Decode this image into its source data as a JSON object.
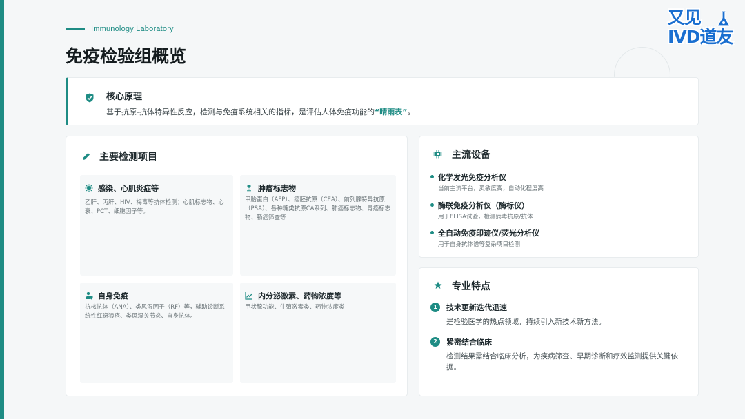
{
  "header": {
    "subtitle": "Immunology Laboratory",
    "title": "免疫检验组概览"
  },
  "logo": {
    "line1": "又见",
    "line2": "IVD道友"
  },
  "principle": {
    "title": "核心原理",
    "desc_prefix": "基于抗原-抗体特异性反应，检测与免疫系统相关的指标，是评估人体免疫功能的",
    "desc_highlight": "“晴雨表”",
    "desc_suffix": "。",
    "icon": "shield-check-icon"
  },
  "items": {
    "title": "主要检测项目",
    "icon": "pencil-icon",
    "cards": [
      {
        "title": "感染、心肌炎症等",
        "icon": "virus-icon",
        "desc": "乙肝、丙肝、HIV、梅毒等抗体检测；心肌标志物、心衰、PCT、细胞因子等。"
      },
      {
        "title": "肿瘤标志物",
        "icon": "ribbon-icon",
        "desc": "甲胎蛋白（AFP）、癌胚抗原（CEA）、前列腺特异抗原（PSA）、各种糖类抗原CA系列、肺癌标志物、胃癌标志物、肠癌筛查等"
      },
      {
        "title": "自身免疫",
        "icon": "user-shield-icon",
        "desc": "抗核抗体（ANA）、类风湿因子（RF）等，辅助诊断系统性红斑狼疮、类风湿关节炎、自身抗体。"
      },
      {
        "title": "内分泌激素、药物浓度等",
        "icon": "chart-line-icon",
        "desc": "甲状腺功能、生殖激素类、药物浓度类"
      }
    ]
  },
  "equipment": {
    "title": "主流设备",
    "icon": "chip-icon",
    "list": [
      {
        "name": "化学发光免疫分析仪",
        "desc": "当前主流平台，灵敏度高，自动化程度高"
      },
      {
        "name": "酶联免疫分析仪（酶标仪）",
        "desc": "用于ELISA试验，检测病毒抗原/抗体"
      },
      {
        "name": "全自动免疫印迹仪/荧光分析仪",
        "desc": "用于自身抗体谱等复杂项目检测"
      }
    ]
  },
  "features": {
    "title": "专业特点",
    "icon": "star-icon",
    "list": [
      {
        "num": "1",
        "title": "技术更新迭代迅速",
        "desc": "是检验医学的热点领域，持续引入新技术新方法。"
      },
      {
        "num": "2",
        "title": "紧密结合临床",
        "desc": "检测结果需结合临床分析，为疾病筛查、早期诊断和疗效监测提供关键依据。"
      }
    ]
  },
  "colors": {
    "accent": "#1e8c84",
    "logo": "#1a6fd0"
  }
}
